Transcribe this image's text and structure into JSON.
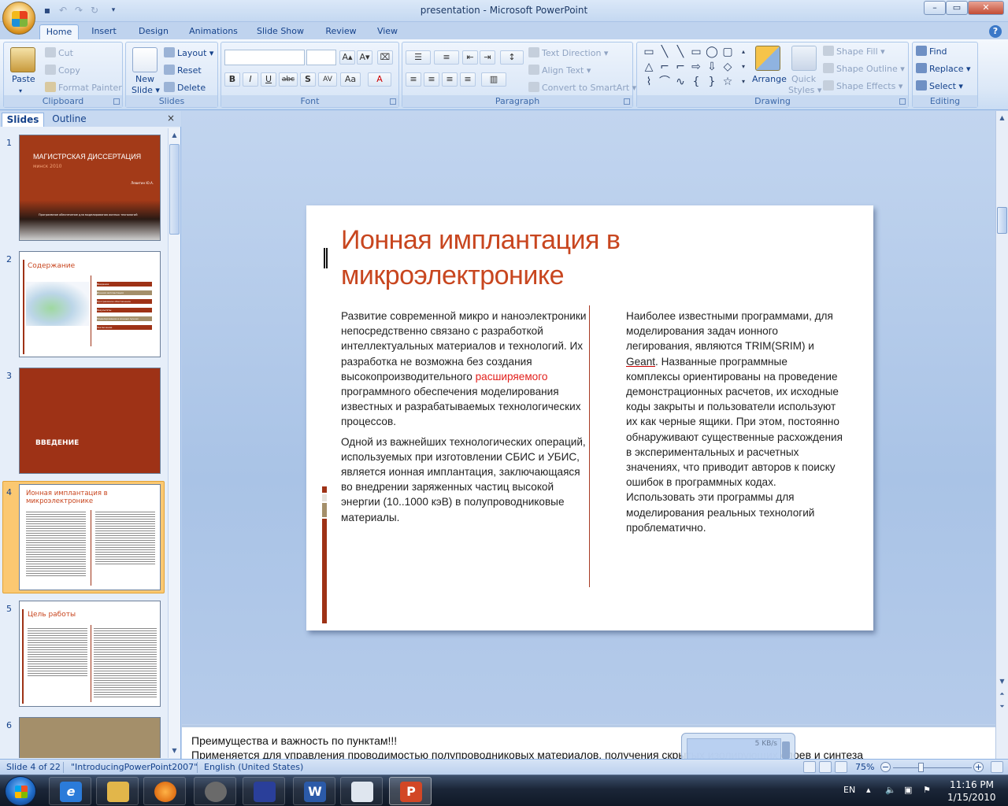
{
  "window": {
    "title": "presentation - Microsoft PowerPoint",
    "controls": {
      "minimize": "–",
      "maximize": "▭",
      "close": "✕"
    }
  },
  "ribbon": {
    "tabs": [
      "Home",
      "Insert",
      "Design",
      "Animations",
      "Slide Show",
      "Review",
      "View"
    ],
    "active_tab": "Home",
    "clipboard": {
      "paste": "Paste",
      "cut": "Cut",
      "copy": "Copy",
      "format_painter": "Format Painter",
      "label": "Clipboard"
    },
    "slides": {
      "new_slide_line1": "New",
      "new_slide_line2": "Slide ▾",
      "layout": "Layout ▾",
      "reset": "Reset",
      "delete": "Delete",
      "label": "Slides"
    },
    "font": {
      "label": "Font",
      "bold": "B",
      "italic": "I",
      "underline": "U",
      "strike": "abc",
      "shadow": "S",
      "spacing": "AV",
      "case": "Aa",
      "color": "A",
      "grow": "A▴",
      "shrink": "A▾"
    },
    "paragraph": {
      "label": "Paragraph",
      "text_direction": "Text Direction ▾",
      "align_text": "Align Text ▾",
      "convert_smartart": "Convert to SmartArt ▾"
    },
    "drawing": {
      "label": "Drawing",
      "arrange": "Arrange",
      "quick_styles_line1": "Quick",
      "quick_styles_line2": "Styles ▾",
      "shape_fill": "Shape Fill ▾",
      "shape_outline": "Shape Outline ▾",
      "shape_effects": "Shape Effects ▾"
    },
    "editing": {
      "label": "Editing",
      "find": "Find",
      "replace": "Replace ▾",
      "select": "Select ▾"
    }
  },
  "pane": {
    "tabs": {
      "slides": "Slides",
      "outline": "Outline"
    },
    "close": "×",
    "thumbnails": [
      {
        "num": "1",
        "title": "МАГИСТРСКАЯ ДИССЕРТАЦИЯ",
        "subtitle": "минск 2010",
        "author": "Левитин Ю.А.",
        "footer": "Программное обеспечение  для моделирования  ионных  технологий"
      },
      {
        "num": "2",
        "title": "Содержание",
        "items": [
          "Введение",
          "Ионная имплантация",
          "Программное обеспечение",
          "Результаты",
          "Моделирование в ионных пучках",
          "Заключение"
        ]
      },
      {
        "num": "3",
        "title": "ВВЕДЕНИЕ"
      },
      {
        "num": "4",
        "title": "Ионная имплантация в микроэлектронике"
      },
      {
        "num": "5",
        "title": "Цель работы"
      },
      {
        "num": "6"
      }
    ]
  },
  "slide": {
    "title": "Ионная имплантация в микроэлектронике",
    "left_p1_a": "Развитие современной микро и наноэлектроники непосредственно связано с разработкой интеллектуальных материалов и технологий. Их разработка не возможна без создания высокопроизводительного ",
    "left_p1_red": "расширяемого",
    "left_p1_b": " программного обеспечения моделирования известных и разрабатываемых технологических процессов.",
    "left_p2": "Одной из важнейших технологических операций, используемых при изготовлении СБИС и УБИС, является ионная имплантация, заключающаяся во внедрении заряженных частиц высокой энергии (10..1000 кэВ) в полупроводниковые материалы.",
    "right_a": "Наиболее известными программами, для моделирования задач ионного легирования,  являются TRIM(SRIM)  и ",
    "right_link": "Geant",
    "right_b": ". Названные программные комплексы ориентированы на проведение демонстрационных расчетов, их исходные коды закрыты и пользователи используют их как черные ящики. При этом,  постоянно обнаруживают существенные расхождения в экспериментальных и расчетных значениях, что приводит авторов к поиску ошибок в программных кодах. Использовать эти программы для моделирования реальных технологий проблематично."
  },
  "notes": {
    "line1": "Преимущества и важность по пунктам!!!",
    "line2": "Применяется для управления проводимостью полупроводниковых материалов, получения скрытых изолирующих слоев и синтеза"
  },
  "net_widget": {
    "speed": "5 KB/s"
  },
  "status": {
    "slide_of": "Slide 4 of 22",
    "theme": "\"IntroducingPowerPoint2007\"",
    "language": "English (United States)",
    "zoom": "75%",
    "zoom_minus": "−",
    "zoom_plus": "+"
  },
  "taskbar": {
    "language": "EN",
    "time": "11:16 PM",
    "date": "1/15/2010",
    "apps": [
      "internet-explorer",
      "windows-explorer",
      "firefox",
      "alienware",
      "save-tool",
      "word",
      "print-tool",
      "powerpoint"
    ]
  },
  "colors": {
    "title_accent": "#c8461f",
    "thumb_dark_red": "#9e3216",
    "thumb_tan": "#a48f6a",
    "selection": "#fbc871"
  }
}
